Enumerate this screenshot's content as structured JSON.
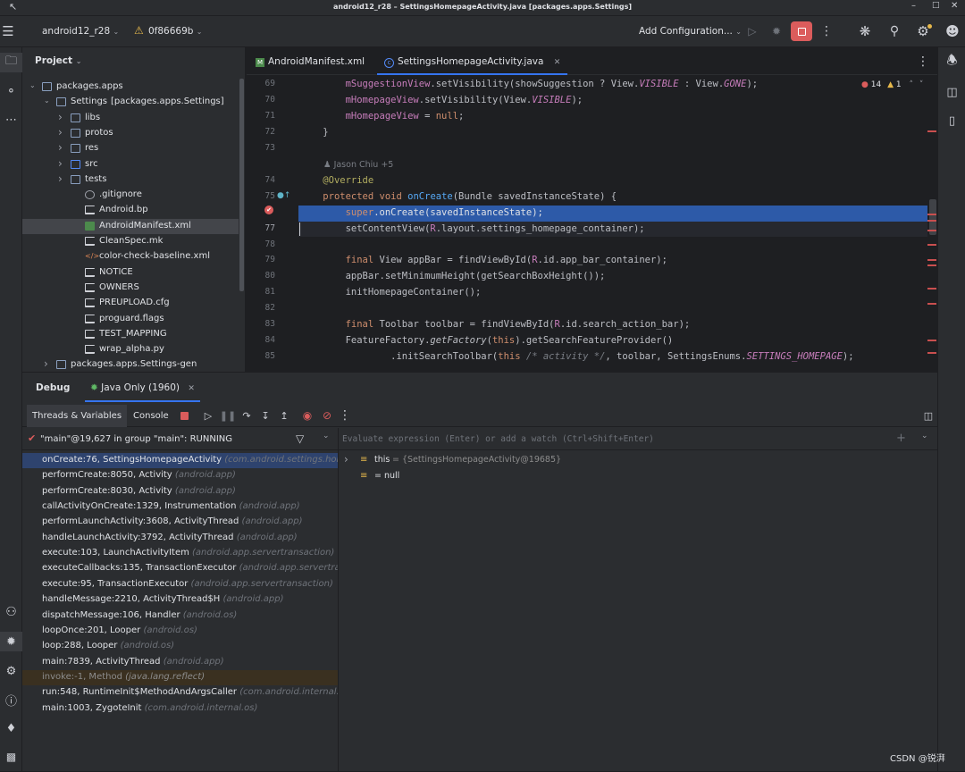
{
  "window_title": "android12_r28 – SettingsHomepageActivity.java [packages.apps.Settings]",
  "toolbar": {
    "project_name": "android12_r28",
    "vcs_label": "0f86669b",
    "config_label": "Add Configuration..."
  },
  "project_panel": {
    "title": "Project",
    "items": [
      {
        "label": "packages.apps",
        "depth": 0,
        "kind": "folder",
        "expanded": true
      },
      {
        "label": "Settings",
        "suffix": "[packages.apps.Settings]",
        "depth": 1,
        "kind": "module",
        "expanded": true
      },
      {
        "label": "libs",
        "depth": 2,
        "kind": "folder"
      },
      {
        "label": "protos",
        "depth": 2,
        "kind": "folder"
      },
      {
        "label": "res",
        "depth": 2,
        "kind": "folder"
      },
      {
        "label": "src",
        "depth": 2,
        "kind": "src"
      },
      {
        "label": "tests",
        "depth": 2,
        "kind": "folder"
      },
      {
        "label": ".gitignore",
        "depth": 3,
        "kind": "ignore"
      },
      {
        "label": "Android.bp",
        "depth": 3,
        "kind": "file"
      },
      {
        "label": "AndroidManifest.xml",
        "depth": 3,
        "kind": "manifest",
        "selected": true
      },
      {
        "label": "CleanSpec.mk",
        "depth": 3,
        "kind": "file"
      },
      {
        "label": "color-check-baseline.xml",
        "depth": 3,
        "kind": "xml"
      },
      {
        "label": "NOTICE",
        "depth": 3,
        "kind": "file"
      },
      {
        "label": "OWNERS",
        "depth": 3,
        "kind": "file"
      },
      {
        "label": "PREUPLOAD.cfg",
        "depth": 3,
        "kind": "file"
      },
      {
        "label": "proguard.flags",
        "depth": 3,
        "kind": "file"
      },
      {
        "label": "TEST_MAPPING",
        "depth": 3,
        "kind": "file"
      },
      {
        "label": "wrap_alpha.py",
        "depth": 3,
        "kind": "file"
      },
      {
        "label": "packages.apps.Settings-gen",
        "depth": 1,
        "kind": "module",
        "expanded": false
      }
    ]
  },
  "editor": {
    "tabs": [
      {
        "label": "AndroidManifest.xml",
        "active": false
      },
      {
        "label": "SettingsHomepageActivity.java",
        "active": true
      }
    ],
    "inspection": {
      "errors": "14",
      "warnings": "1"
    },
    "author_hint": "Jason Chiu +5",
    "lines": [
      {
        "num": "69",
        "text": "        mSuggestionView.setVisibility(showSuggestion ? View.VISIBLE : View.GONE);"
      },
      {
        "num": "70",
        "text": "        mHomepageView.setVisibility(View.VISIBLE);"
      },
      {
        "num": "71",
        "text": "        mHomepageView = null;"
      },
      {
        "num": "72",
        "text": "    }"
      },
      {
        "num": "73",
        "text": ""
      },
      {
        "num": "",
        "text": ""
      },
      {
        "num": "74",
        "text": "    @Override"
      },
      {
        "num": "75",
        "text": "    protected void onCreate(Bundle savedInstanceState) {"
      },
      {
        "num": "",
        "text": "        super.onCreate(savedInstanceState);"
      },
      {
        "num": "77",
        "text": "        setContentView(R.layout.settings_homepage_container);"
      },
      {
        "num": "78",
        "text": ""
      },
      {
        "num": "79",
        "text": "        final View appBar = findViewById(R.id.app_bar_container);"
      },
      {
        "num": "80",
        "text": "        appBar.setMinimumHeight(getSearchBoxHeight());"
      },
      {
        "num": "81",
        "text": "        initHomepageContainer();"
      },
      {
        "num": "82",
        "text": ""
      },
      {
        "num": "83",
        "text": "        final Toolbar toolbar = findViewById(R.id.search_action_bar);"
      },
      {
        "num": "84",
        "text": "        FeatureFactory.getFactory(this).getSearchFeatureProvider()"
      },
      {
        "num": "85",
        "text": "                .initSearchToolbar(this /* activity */, toolbar, SettingsEnums.SETTINGS_HOMEPAGE);"
      }
    ]
  },
  "debug": {
    "title": "Debug",
    "session_tab": "Java Only (1960)",
    "subtabs": {
      "threads": "Threads & Variables",
      "console": "Console"
    },
    "thread_status": "\"main\"@19,627 in group \"main\": RUNNING",
    "eval_placeholder": "Evaluate expression (Enter) or add a watch (Ctrl+Shift+Enter)",
    "frames": [
      {
        "method": "onCreate:76, SettingsHomepageActivity",
        "pkg": "(com.android.settings.homepage)",
        "selected": true
      },
      {
        "method": "performCreate:8050, Activity",
        "pkg": "(android.app)"
      },
      {
        "method": "performCreate:8030, Activity",
        "pkg": "(android.app)"
      },
      {
        "method": "callActivityOnCreate:1329, Instrumentation",
        "pkg": "(android.app)"
      },
      {
        "method": "performLaunchActivity:3608, ActivityThread",
        "pkg": "(android.app)"
      },
      {
        "method": "handleLaunchActivity:3792, ActivityThread",
        "pkg": "(android.app)"
      },
      {
        "method": "execute:103, LaunchActivityItem",
        "pkg": "(android.app.servertransaction)"
      },
      {
        "method": "executeCallbacks:135, TransactionExecutor",
        "pkg": "(android.app.servertransaction)"
      },
      {
        "method": "execute:95, TransactionExecutor",
        "pkg": "(android.app.servertransaction)"
      },
      {
        "method": "handleMessage:2210, ActivityThread$H",
        "pkg": "(android.app)"
      },
      {
        "method": "dispatchMessage:106, Handler",
        "pkg": "(android.os)"
      },
      {
        "method": "loopOnce:201, Looper",
        "pkg": "(android.os)"
      },
      {
        "method": "loop:288, Looper",
        "pkg": "(android.os)"
      },
      {
        "method": "main:7839, ActivityThread",
        "pkg": "(android.app)"
      },
      {
        "method": "invoke:-1, Method",
        "pkg": "(java.lang.reflect)",
        "library": true
      },
      {
        "method": "run:548, RuntimeInit$MethodAndArgsCaller",
        "pkg": "(com.android.internal.os)"
      },
      {
        "method": "main:1003, ZygoteInit",
        "pkg": "(com.android.internal.os)"
      }
    ],
    "variables": [
      {
        "name": "this",
        "value": "= {SettingsHomepageActivity@19685}",
        "expandable": true
      },
      {
        "name": "",
        "value": "= null",
        "expandable": false
      }
    ]
  },
  "watermark": "CSDN @锐湃",
  "colors": {
    "accent": "#3574f0",
    "stop": "#db5c5c",
    "highlight_line": "#2d5aa8",
    "selection": "#2e436e"
  }
}
